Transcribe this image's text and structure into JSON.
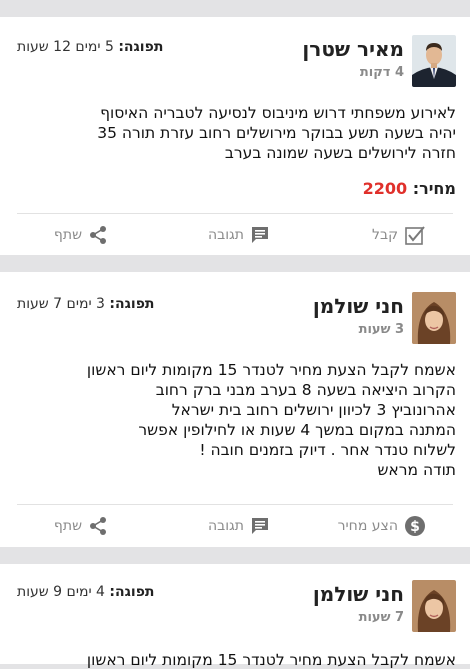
{
  "posts": [
    {
      "name": "מאיר שטרן",
      "ago": "4 דקות",
      "validity_label": "תפוגה:",
      "validity_value": "5 ימים 12 שעות",
      "text": "לאירוע משפחתי דרוש מיניבוס לנסיעה לטבריה האיסוף\nיהיה בשעה תשע בבוקר מירושלים רחוב עזרת תורה 35\nחזרה לירושלים בשעה שמונה בערב",
      "price_label": "מחיר:",
      "price_value": "2200",
      "actions": {
        "primary": "קבל",
        "primary_icon": "checkbox-icon",
        "reply": "תגובה",
        "share": "שתף"
      }
    },
    {
      "name": "חני שולמן",
      "ago": "3 שעות",
      "validity_label": "תפוגה:",
      "validity_value": "3 ימים 7 שעות",
      "text": "אשמח לקבל הצעת מחיר לטנדר 15 מקומות ליום ראשון\nהקרוב היציאה בשעה 8 בערב מבני ברק רחוב\nאהרונוביץ 3 לכיוון ירושלים רחוב בית ישראל\nהמתנה במקום במשך 4 שעות או לחילופין אפשר\nלשלוח טנדר אחר . דיוק בזמנים חובה !\nתודה מראש",
      "actions": {
        "primary": "הצע מחיר",
        "primary_icon": "dollar-icon",
        "reply": "תגובה",
        "share": "שתף"
      }
    },
    {
      "name": "חני שולמן",
      "ago": "7 שעות",
      "validity_label": "תפוגה:",
      "validity_value": "4 ימים 9 שעות",
      "text": "אשמח לקבל הצעת מחיר לטנדר 15 מקומות ליום ראשון"
    }
  ],
  "colors": {
    "background": "#e3e3e5",
    "card": "#ffffff",
    "price": "#e0302b",
    "muted": "#8b8b8b"
  }
}
